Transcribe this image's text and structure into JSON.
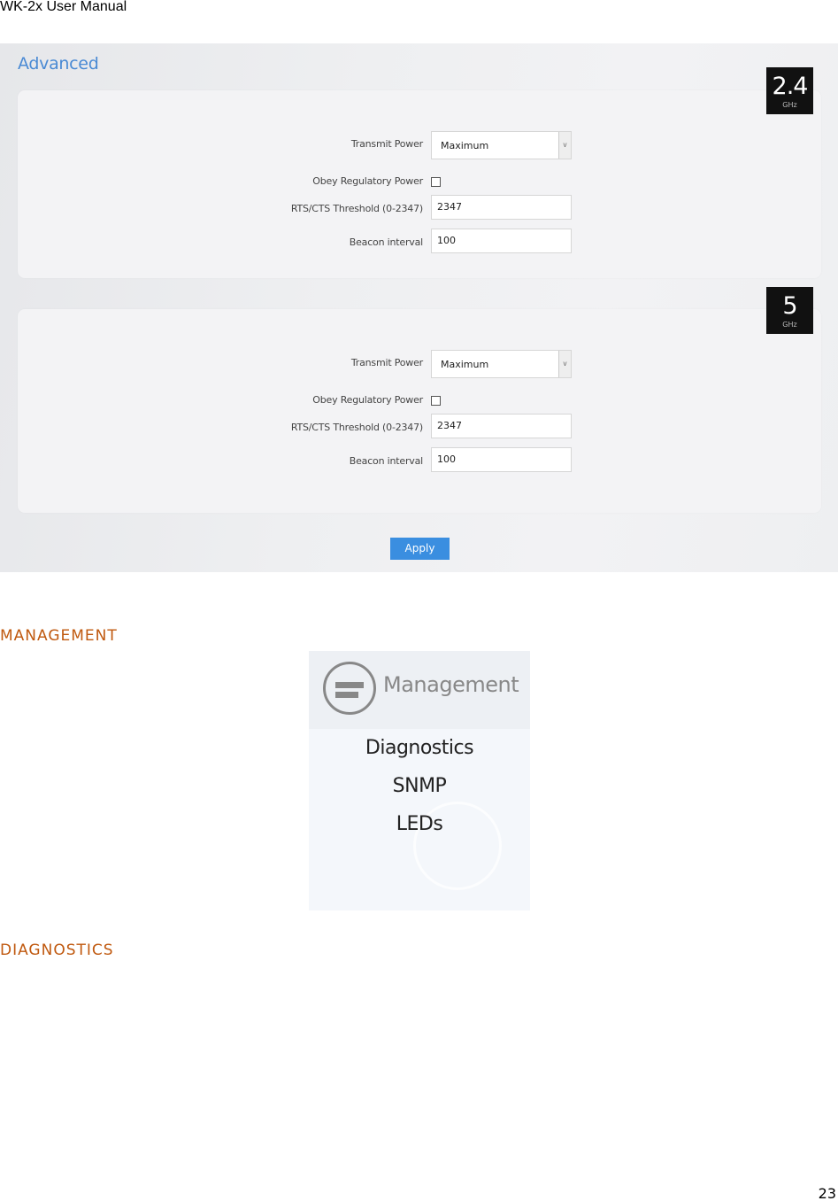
{
  "document": {
    "header": "WK-2x User Manual",
    "page_number": "23"
  },
  "advanced": {
    "title": "Advanced",
    "bands": [
      {
        "badge_number": "2.4",
        "badge_unit": "GHz",
        "fields": {
          "transmit_power_label": "Transmit Power",
          "transmit_power_value": "Maximum",
          "obey_regulatory_label": "Obey Regulatory Power",
          "obey_regulatory_checked": false,
          "rts_cts_label": "RTS/CTS Threshold (0-2347)",
          "rts_cts_value": "2347",
          "beacon_label": "Beacon interval",
          "beacon_value": "100"
        }
      },
      {
        "badge_number": "5",
        "badge_unit": "GHz",
        "fields": {
          "transmit_power_label": "Transmit Power",
          "transmit_power_value": "Maximum",
          "obey_regulatory_label": "Obey Regulatory Power",
          "obey_regulatory_checked": false,
          "rts_cts_label": "RTS/CTS Threshold (0-2347)",
          "rts_cts_value": "2347",
          "beacon_label": "Beacon interval",
          "beacon_value": "100"
        }
      }
    ],
    "apply_label": "Apply",
    "select_arrow": "v"
  },
  "sections": {
    "management_heading": "MANAGEMENT",
    "diagnostics_heading": "DIAGNOSTICS"
  },
  "management_menu": {
    "title": "Management",
    "icon": "management-icon",
    "items": [
      "Diagnostics",
      "SNMP",
      "LEDs"
    ]
  },
  "colors": {
    "accent_blue": "#3a8ee0",
    "title_blue": "#4a8ad4",
    "heading_orange": "#c0590f",
    "badge_bg": "#111111"
  }
}
